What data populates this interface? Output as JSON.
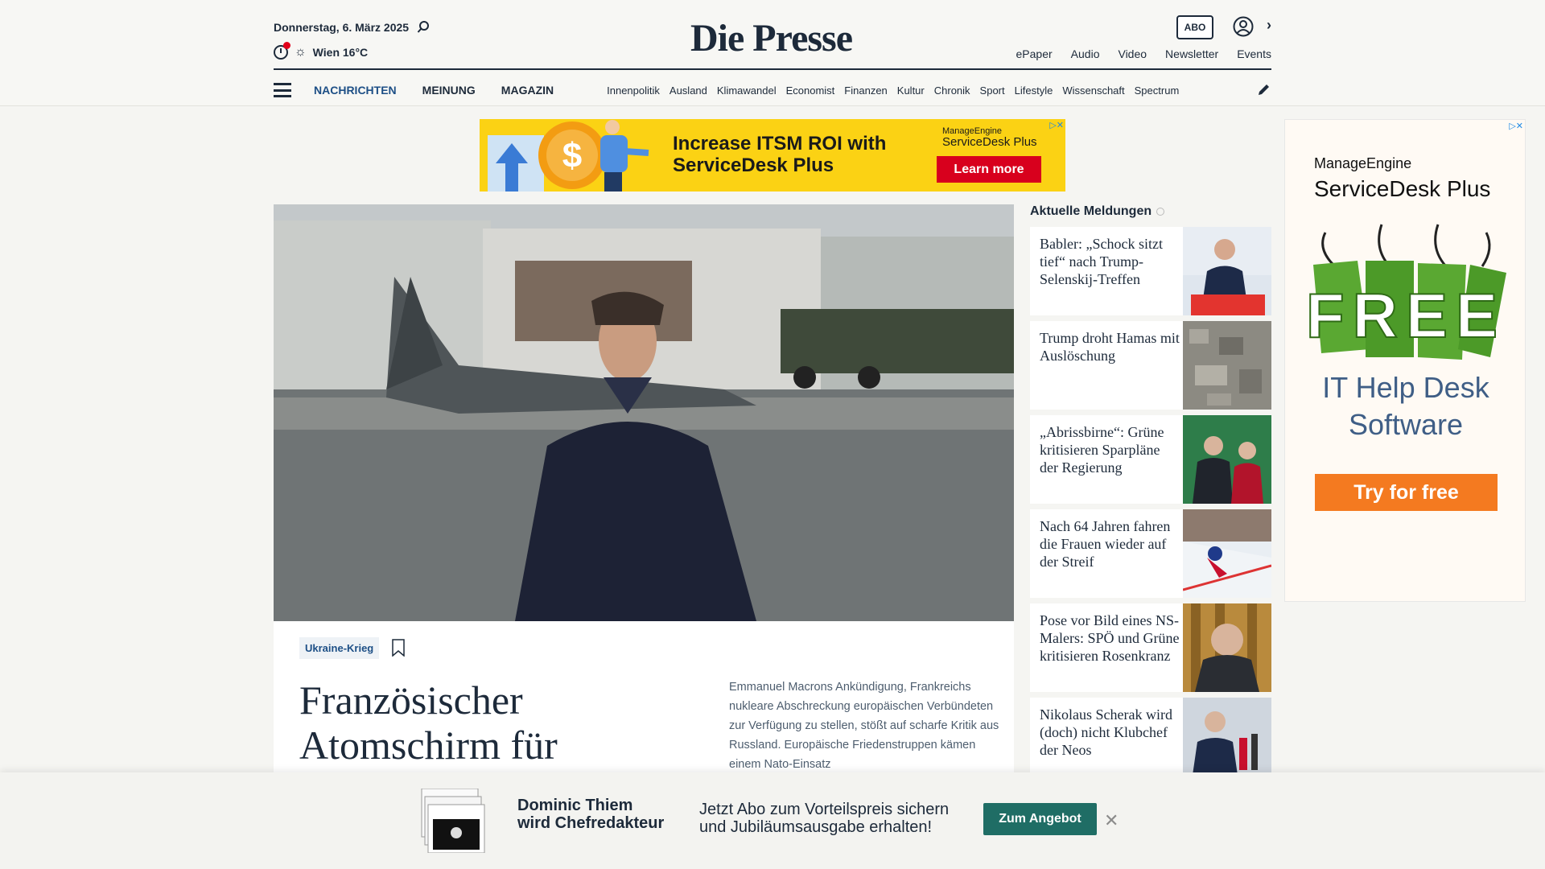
{
  "header": {
    "date": "Donnerstag, 6. März 2025",
    "weather": "Wien 16°C",
    "logo": "Die Presse",
    "abo_label": "ABO",
    "top_links": [
      "ePaper",
      "Audio",
      "Video",
      "Newsletter",
      "Events"
    ]
  },
  "nav": {
    "main": [
      "NACHRICHTEN",
      "MEINUNG",
      "MAGAZIN"
    ],
    "sub": [
      "Innenpolitik",
      "Ausland",
      "Klimawandel",
      "Economist",
      "Finanzen",
      "Kultur",
      "Chronik",
      "Sport",
      "Lifestyle",
      "Wissenschaft",
      "Spectrum"
    ]
  },
  "ad_banner": {
    "headline_1": "Increase ITSM ROI with",
    "headline_2": "ServiceDesk Plus",
    "brand": "ManageEngine",
    "product": "ServiceDesk Plus",
    "cta": "Learn more"
  },
  "hero": {
    "topic": "Ukraine-Krieg",
    "title": "Französischer Atomschirm für",
    "lead": "Emmanuel Macrons Ankündigung, Frankreichs nukleare Abschreckung europäischen Verbündeten zur Verfügung zu stellen, stößt auf scharfe Kritik aus Russland. Europäische Friedenstruppen kämen einem Nato-Einsatz"
  },
  "sidebar": {
    "heading": "Aktuelle Meldungen",
    "items": [
      {
        "title": "Babler: „Schock sitzt tief“ nach Trump-Selenskij-Treffen"
      },
      {
        "title": "Trump droht Hamas mit Auslöschung"
      },
      {
        "title": "„Abrissbirne“: Grüne kritisieren Sparpläne der Regierung"
      },
      {
        "title": "Nach 64 Jahren fahren die Frauen wieder auf der Streif"
      },
      {
        "title": "Pose vor Bild eines NS-Malers: SPÖ und Grüne kritisieren Rosenkranz"
      },
      {
        "title": "Nikolaus Scherak wird (doch) nicht Klubchef der Neos"
      }
    ]
  },
  "ad_sky": {
    "brand": "ManageEngine",
    "product": "ServiceDesk Plus",
    "badge": "FREE",
    "heading_1": "IT Help Desk",
    "heading_2": "Software",
    "cta": "Try for free"
  },
  "promo": {
    "name_1": "Dominic Thiem",
    "name_2": "wird Chefredakteur",
    "text_1": "Jetzt Abo zum Vorteilspreis sichern",
    "text_2": "und Jubiläumsausgabe erhalten!",
    "button": "Zum Angebot"
  }
}
